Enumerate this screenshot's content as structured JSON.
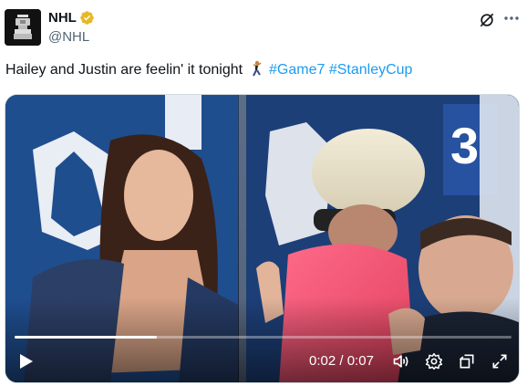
{
  "account": {
    "name": "NHL",
    "handle": "@NHL",
    "verified": true,
    "avatar_icon": "stanley-cup-logo-icon"
  },
  "tweet": {
    "text_before": "Hailey and Justin are feelin' it tonight",
    "emoji_icon": "man-dancing-icon",
    "hashtags": [
      "#Game7",
      "#StanleyCup"
    ]
  },
  "video": {
    "current_time": "0:02",
    "duration": "0:07",
    "time_display": "0:02 / 0:07",
    "progress": 0.286,
    "controls": [
      "play-icon",
      "volume-icon",
      "settings-icon",
      "picture-in-picture-icon",
      "fullscreen-icon"
    ]
  },
  "colors": {
    "link": "#1d9bf0",
    "verified_gold": "#e8b829",
    "text_primary": "#0f1419",
    "text_secondary": "#536471"
  }
}
